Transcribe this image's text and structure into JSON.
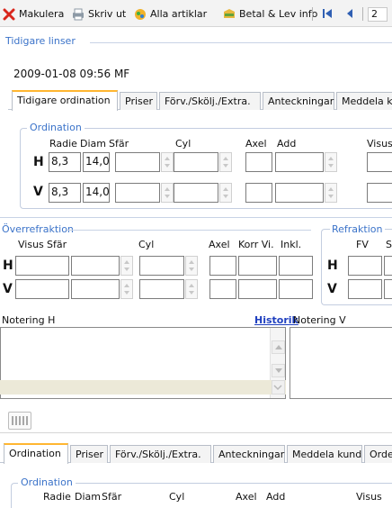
{
  "toolbar": {
    "makulera": "Makulera",
    "skriv_ut": "Skriv ut",
    "alla_artiklar": "Alla artiklar",
    "betal_lev": "Betal & Lev info",
    "page_num": "2"
  },
  "tidigare_linser": {
    "title": "Tidigare linser",
    "record": "2009-01-08 09:56  MF",
    "tabs": [
      "Tidigare ordination",
      "Priser",
      "Förv./Skölj./Extra.",
      "Anteckningar",
      "Meddela ku"
    ],
    "ordination": {
      "title": "Ordination",
      "headers": [
        "Radie",
        "Diam",
        "Sfär",
        "Cyl",
        "Axel",
        "Add",
        "Visus"
      ],
      "rows": [
        {
          "label": "H",
          "radie": "8,3",
          "diam": "14,0"
        },
        {
          "label": "V",
          "radie": "8,3",
          "diam": "14,0"
        }
      ]
    }
  },
  "overrefraktion": {
    "title": "Överrefraktion",
    "headers": [
      "Visus",
      "Sfär",
      "Cyl",
      "Axel",
      "Korr Vi.",
      "Inkl."
    ],
    "rows": [
      "H",
      "V"
    ]
  },
  "refraktion": {
    "title": "Refraktion",
    "headers": [
      "FV",
      "Sf"
    ],
    "rows": [
      "H",
      "V"
    ]
  },
  "notering": {
    "h_label": "Notering H",
    "historik": "Historik",
    "v_label": "Notering V"
  },
  "bottom": {
    "tabs": [
      "Ordination",
      "Priser",
      "Förv./Skölj./Extra.",
      "Anteckningar",
      "Meddela kund",
      "Orde"
    ],
    "ordination": {
      "title": "Ordination",
      "headers": [
        "Radie",
        "Diam",
        "Sfär",
        "Cyl",
        "Axel",
        "Add",
        "Visus"
      ]
    }
  },
  "colors": {
    "group_title": "#3b73c9",
    "active_tab_border": "#ffb631",
    "link": "#1f3fbf"
  }
}
